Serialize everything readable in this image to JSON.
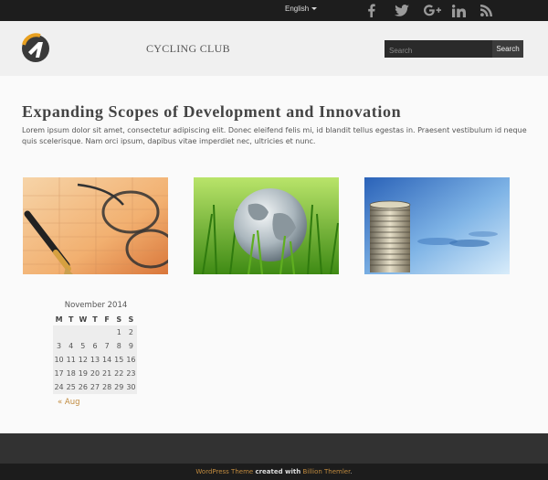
{
  "topbar": {
    "language": "English",
    "social": [
      "facebook-icon",
      "twitter-icon",
      "google-plus-icon",
      "linkedin-icon",
      "rss-icon"
    ]
  },
  "header": {
    "site_title": "CYCLING CLUB",
    "search_placeholder": "Search",
    "search_button": "Search"
  },
  "main": {
    "heading": "Expanding Scopes of Development and Innovation",
    "intro": "Lorem ipsum dolor sit amet, consectetur adipiscing elit. Donec eleifend felis mi, id blandit tellus egestas in. Praesent vestibulum id neque quis scelerisque. Nam orci ipsum, dapibus vitae imperdiet nec, ultricies et nunc.",
    "images": [
      "pen-and-glasses-image",
      "globe-in-grass-image",
      "coin-stack-image"
    ]
  },
  "calendar": {
    "caption": "November 2014",
    "days": [
      "M",
      "T",
      "W",
      "T",
      "F",
      "S",
      "S"
    ],
    "weeks": [
      [
        "",
        "",
        "",
        "",
        "",
        "1",
        "2"
      ],
      [
        "3",
        "4",
        "5",
        "6",
        "7",
        "8",
        "9"
      ],
      [
        "10",
        "11",
        "12",
        "13",
        "14",
        "15",
        "16"
      ],
      [
        "17",
        "18",
        "19",
        "20",
        "21",
        "22",
        "23"
      ],
      [
        "24",
        "25",
        "26",
        "27",
        "28",
        "29",
        "30"
      ]
    ],
    "prev_link": "« Aug"
  },
  "footer": {
    "theme_link": "WordPress Theme",
    "created_with": "created with",
    "author_link": "Billion Themler",
    "period": "."
  },
  "colors": {
    "topbar_bg": "#1d1d1d",
    "accent_link": "#c08a3e",
    "footer_bg": "#323232"
  }
}
